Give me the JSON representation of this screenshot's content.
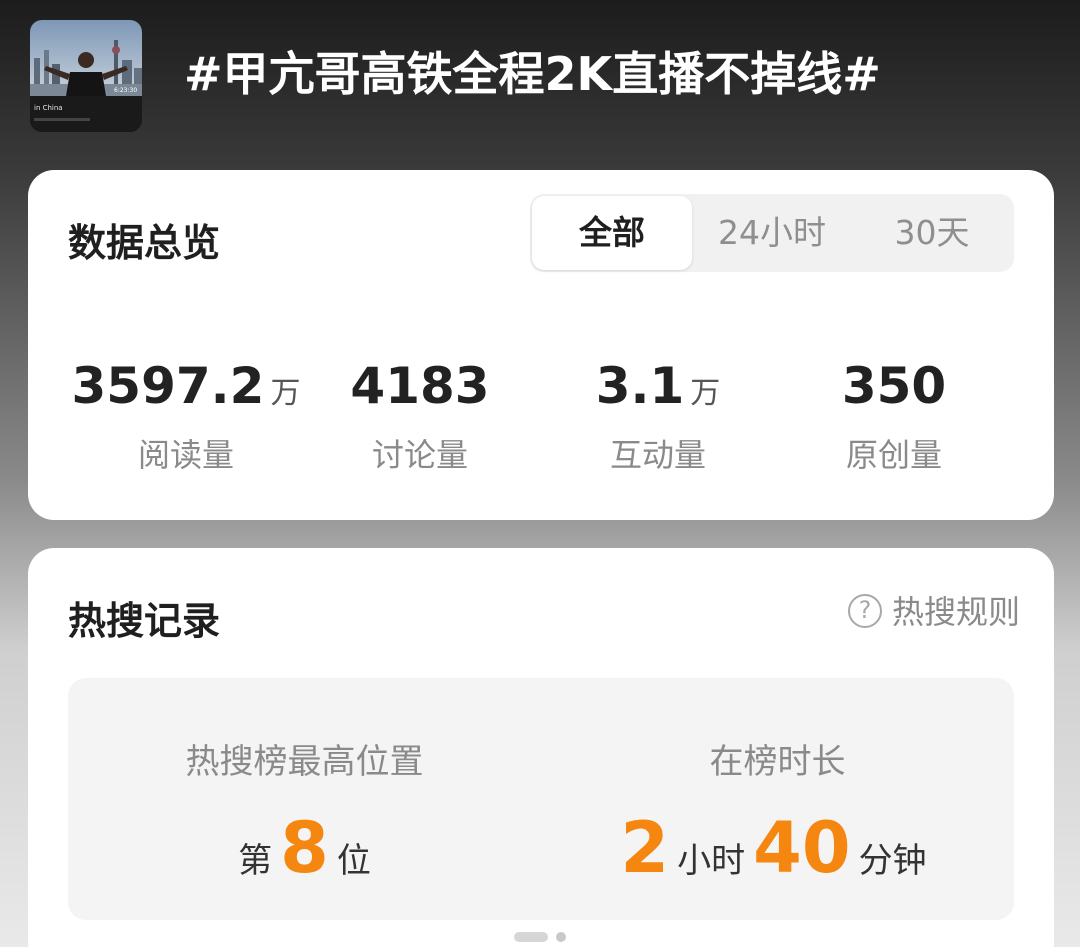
{
  "topic": {
    "thumbnail_caption": "in China",
    "thumbnail_time": "6:23:30",
    "title": "#甲亢哥高铁全程2K直播不掉线#"
  },
  "overview": {
    "title": "数据总览",
    "tabs": [
      {
        "label": "全部",
        "active": true
      },
      {
        "label": "24小时",
        "active": false
      },
      {
        "label": "30天",
        "active": false
      }
    ],
    "stats": [
      {
        "value": "3597.2",
        "unit": "万",
        "label": "阅读量"
      },
      {
        "value": "4183",
        "unit": "",
        "label": "讨论量"
      },
      {
        "value": "3.1",
        "unit": "万",
        "label": "互动量"
      },
      {
        "value": "350",
        "unit": "",
        "label": "原创量"
      }
    ]
  },
  "hot_search": {
    "title": "热搜记录",
    "rules_link": "热搜规则",
    "help_icon_glyph": "?",
    "highest_position": {
      "label": "热搜榜最高位置",
      "prefix": "第",
      "number": "8",
      "suffix": "位"
    },
    "duration": {
      "label": "在榜时长",
      "hours": "2",
      "hours_unit": "小时",
      "minutes": "40",
      "minutes_unit": "分钟"
    },
    "highlight_color": "#f5860f"
  },
  "pager": {
    "active_index": 0,
    "count": 2
  }
}
